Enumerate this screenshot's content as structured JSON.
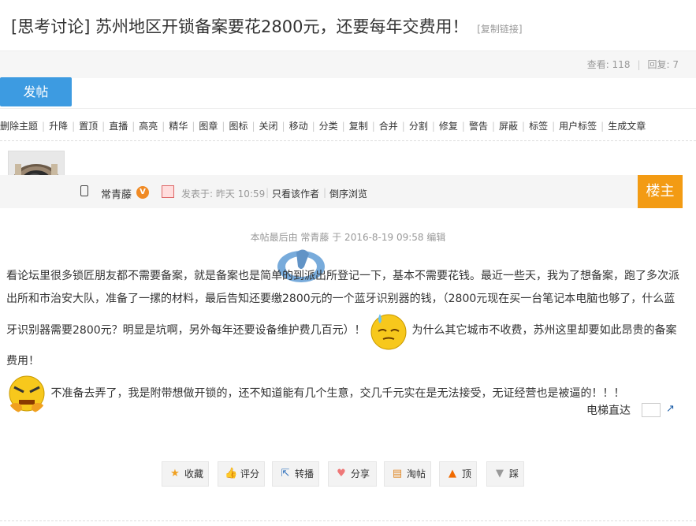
{
  "thread": {
    "title": "[思考讨论] 苏州地区开锁备案要花2800元，还要每年交费用！",
    "copy_link": "[复制链接]",
    "views_label": "查看: 118",
    "replies_label": "回复: 7"
  },
  "toolbar": {
    "post_button": "发帖"
  },
  "admin_actions": [
    "删除主题",
    "升降",
    "置顶",
    "直播",
    "高亮",
    "精华",
    "图章",
    "图标",
    "关闭",
    "移动",
    "分类",
    "复制",
    "合并",
    "分割",
    "修复",
    "警告",
    "屏蔽",
    "标签",
    "用户标签",
    "生成文章"
  ],
  "post": {
    "author": "常青藤",
    "vip_badge": "V",
    "posted_at": "发表于: 昨天 10:59",
    "author_only": "只看该作者",
    "reverse_order": "倒序浏览",
    "floor": "楼主",
    "edit_note": "本帖最后由 常青藤 于 2016-8-19 09:58 编辑",
    "para1": "看论坛里很多锁匠朋友都不需要备案，就是备案也是简单的到派出所登记一下，基本不需要花钱。最近一些天，我为了想备案，跑了多次派出所和市治安大队，准备了一摞的材料，最后告知还要缴2800元的一个蓝牙识别器的钱，（2800元现在买一台笔记本电脑也够了，什么蓝牙识别器需要2800元？明显是坑啊，另外每年还要设备维护费几百元）！",
    "para2": "为什么其它城市不收费，苏州这里却要如此昂贵的备案费用！",
    "para3": "不准备去弄了，我是附带想做开锁的，还不知道能有几个生意，交几千元实在是无法接受，无证经营也是被逼的！！！",
    "lift_label": "电梯直达"
  },
  "post_actions": [
    {
      "label": "收藏",
      "icon": "star-icon"
    },
    {
      "label": "评分",
      "icon": "thumb-icon"
    },
    {
      "label": "转播",
      "icon": "share-out-icon"
    },
    {
      "label": "分享",
      "icon": "heart-icon"
    },
    {
      "label": "淘帖",
      "icon": "collection-icon"
    },
    {
      "label": "顶",
      "icon": "up-arrow-icon"
    },
    {
      "label": "踩",
      "icon": "down-arrow-icon"
    }
  ]
}
